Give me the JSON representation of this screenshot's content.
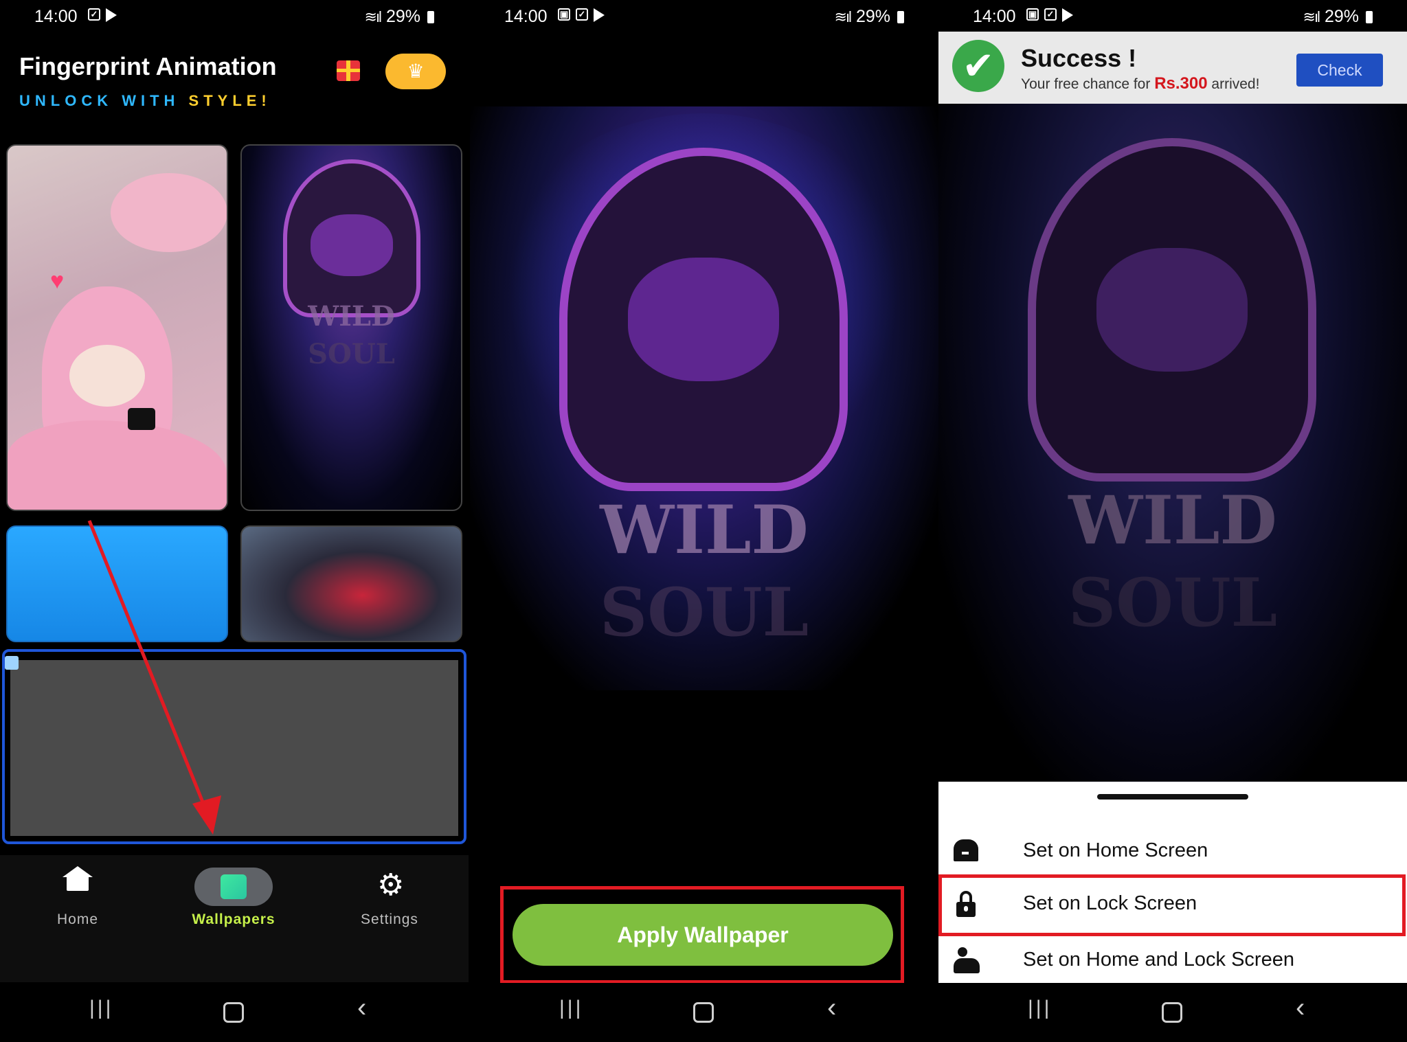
{
  "status_bar": {
    "time": "14:00",
    "battery": "29%"
  },
  "screen1": {
    "app_title": "Fingerprint Animation",
    "tagline_part1": "UNLOCK WITH ",
    "tagline_part2": "STYLE!",
    "icons": [
      "gift-icon",
      "crown-icon"
    ],
    "wallpapers": [
      "pink-bunny-doll",
      "wild-soul-hoodie",
      "blue-splash",
      "spider-man"
    ],
    "ad_placeholder": true,
    "bottom_nav": [
      {
        "label": "Home",
        "icon": "home-icon"
      },
      {
        "label": "Wallpapers",
        "icon": "wallpapers-icon",
        "selected": true
      },
      {
        "label": "Settings",
        "icon": "gear-icon"
      }
    ],
    "annotation": "red-arrow-to-wallpapers-tab"
  },
  "screen2": {
    "wallpaper_text_1": "WILD",
    "wallpaper_text_2": "SOUL",
    "apply_button": "Apply Wallpaper"
  },
  "screen3": {
    "ad": {
      "title": "Success !",
      "subtitle_prefix": "Your free chance for ",
      "amount": "Rs.300",
      "subtitle_suffix": " arrived!",
      "button": "Check"
    },
    "wallpaper_text_1": "WILD",
    "wallpaper_text_2": "SOUL",
    "options": [
      {
        "label": "Set on Home Screen",
        "icon": "home-screen-icon"
      },
      {
        "label": "Set on Lock Screen",
        "icon": "lock-icon",
        "highlighted": true
      },
      {
        "label": "Set on Home and Lock Screen",
        "icon": "home-lock-screen-icon"
      }
    ]
  },
  "colors": {
    "apply_green": "#7fbf3f",
    "highlight_red": "#e21b23",
    "selected_tab": "#c6f04a",
    "ad_border_blue": "#1f56d8",
    "crown_yellow": "#fbb92f"
  }
}
